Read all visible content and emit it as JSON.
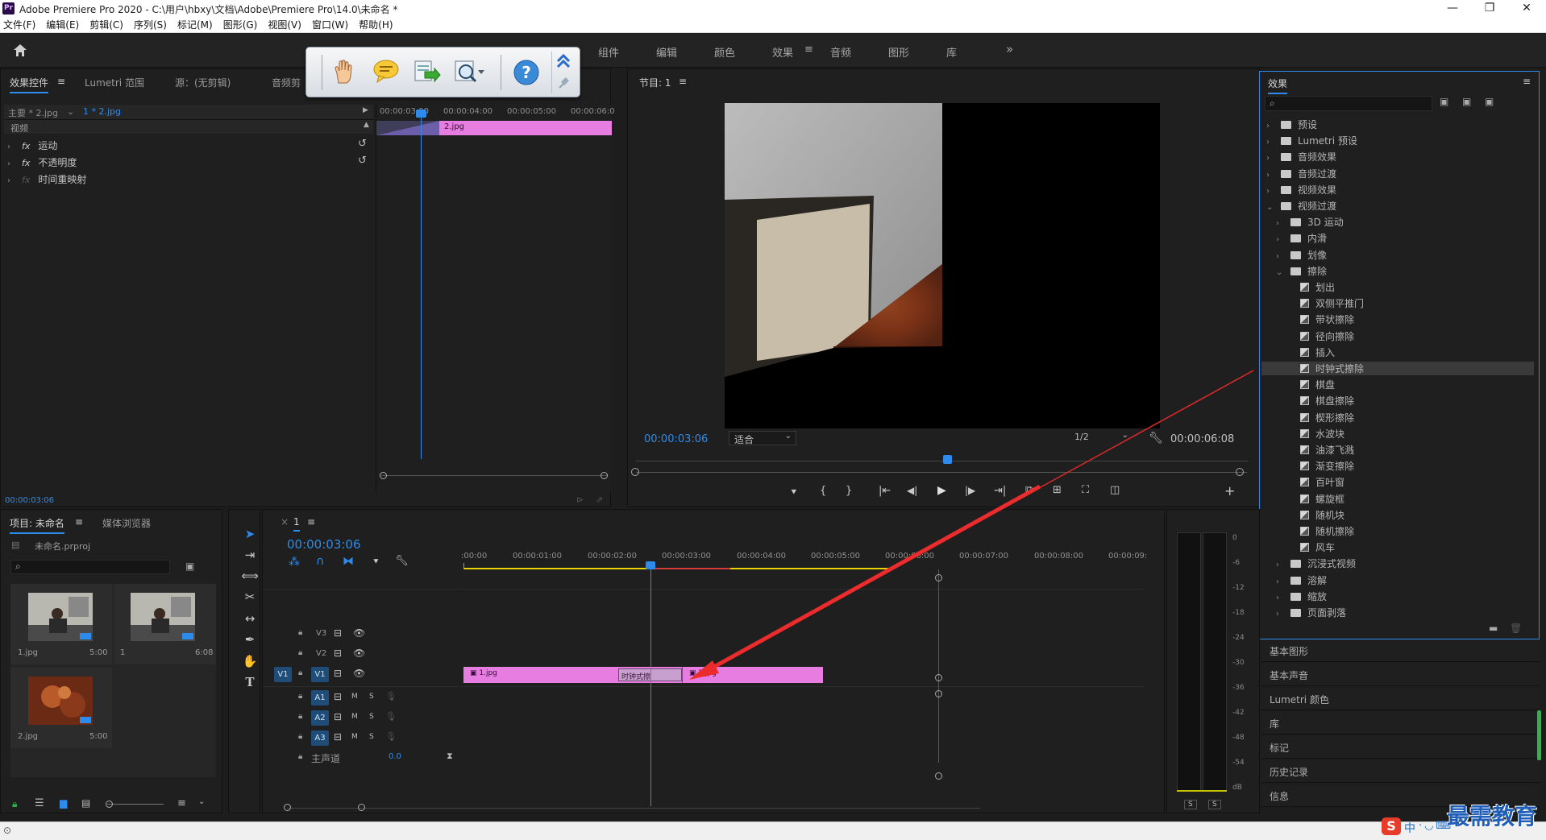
{
  "window": {
    "title": "Adobe Premiere Pro 2020 - C:\\用户\\hbxy\\文档\\Adobe\\Premiere Pro\\14.0\\未命名 *",
    "app_icon": "Pr"
  },
  "menu": [
    "文件(F)",
    "编辑(E)",
    "剪辑(C)",
    "序列(S)",
    "标记(M)",
    "图形(G)",
    "视图(V)",
    "窗口(W)",
    "帮助(H)"
  ],
  "workspaces": {
    "items": [
      "组件",
      "编辑",
      "颜色",
      "效果",
      "音频",
      "图形",
      "库"
    ],
    "active": "效果",
    "more": "»"
  },
  "effect_controls": {
    "tabs": [
      "效果控件",
      "Lumetri 范围",
      "源：(无剪辑)",
      "音频剪"
    ],
    "master": "主要 * 2.jpg",
    "clip": "1 * 2.jpg",
    "timecodes": [
      "00:00:03:00",
      "00:00:04:00",
      "00:00:05:00",
      "00:00:06:0"
    ],
    "section": "视频",
    "clip_label": "2.jpg",
    "props": [
      {
        "name": "运动",
        "fx": "fx"
      },
      {
        "name": "不透明度",
        "fx": "fx"
      },
      {
        "name": "时间重映射",
        "fx": "fx"
      }
    ],
    "current_time": "00:00:03:06"
  },
  "program": {
    "title": "节目: 1",
    "current_time": "00:00:03:06",
    "fit": "适合",
    "resolution": "1/2",
    "duration": "00:00:06:08"
  },
  "effects_panel": {
    "title": "效果",
    "tree": [
      {
        "label": "预设",
        "level": 0,
        "expanded": false
      },
      {
        "label": "Lumetri 预设",
        "level": 0,
        "expanded": false
      },
      {
        "label": "音频效果",
        "level": 0,
        "expanded": false
      },
      {
        "label": "音频过渡",
        "level": 0,
        "expanded": false
      },
      {
        "label": "视频效果",
        "level": 0,
        "expanded": false
      },
      {
        "label": "视频过渡",
        "level": 0,
        "expanded": true
      },
      {
        "label": "3D 运动",
        "level": 1,
        "expanded": false
      },
      {
        "label": "内滑",
        "level": 1,
        "expanded": false
      },
      {
        "label": "划像",
        "level": 1,
        "expanded": false
      },
      {
        "label": "擦除",
        "level": 1,
        "expanded": true
      },
      {
        "label": "划出",
        "level": 2,
        "effect": true
      },
      {
        "label": "双侧平推门",
        "level": 2,
        "effect": true
      },
      {
        "label": "带状擦除",
        "level": 2,
        "effect": true
      },
      {
        "label": "径向擦除",
        "level": 2,
        "effect": true
      },
      {
        "label": "插入",
        "level": 2,
        "effect": true
      },
      {
        "label": "时钟式擦除",
        "level": 2,
        "effect": true,
        "selected": true
      },
      {
        "label": "棋盘",
        "level": 2,
        "effect": true
      },
      {
        "label": "棋盘擦除",
        "level": 2,
        "effect": true
      },
      {
        "label": "楔形擦除",
        "level": 2,
        "effect": true
      },
      {
        "label": "水波块",
        "level": 2,
        "effect": true
      },
      {
        "label": "油漆飞溅",
        "level": 2,
        "effect": true
      },
      {
        "label": "渐变擦除",
        "level": 2,
        "effect": true
      },
      {
        "label": "百叶窗",
        "level": 2,
        "effect": true
      },
      {
        "label": "螺旋框",
        "level": 2,
        "effect": true
      },
      {
        "label": "随机块",
        "level": 2,
        "effect": true
      },
      {
        "label": "随机擦除",
        "level": 2,
        "effect": true
      },
      {
        "label": "风车",
        "level": 2,
        "effect": true
      },
      {
        "label": "沉浸式视频",
        "level": 1,
        "expanded": false
      },
      {
        "label": "溶解",
        "level": 1,
        "expanded": false
      },
      {
        "label": "缩放",
        "level": 1,
        "expanded": false
      },
      {
        "label": "页面剥落",
        "level": 1,
        "expanded": false
      }
    ],
    "side_panels": [
      "基本图形",
      "基本声音",
      "Lumetri 颜色",
      "库",
      "标记",
      "历史记录",
      "信息"
    ]
  },
  "project": {
    "tabs": [
      "项目: 未命名",
      "媒体浏览器"
    ],
    "file": "未命名.prproj",
    "items": [
      {
        "name": "1.jpg",
        "dur": "5:00"
      },
      {
        "name": "1",
        "dur": "6:08"
      },
      {
        "name": "2.jpg",
        "dur": "5:00"
      }
    ]
  },
  "timeline": {
    "tab": "1",
    "current_time": "00:00:03:06",
    "ruler": [
      ":00:00",
      "00:00:01:00",
      "00:00:02:00",
      "00:00:03:00",
      "00:00:04:00",
      "00:00:05:00",
      "00:00:06:00",
      "00:00:07:00",
      "00:00:08:00",
      "00:00:09:"
    ],
    "video_tracks": [
      "V3",
      "V2",
      "V1"
    ],
    "src_patch": "V1",
    "audio_tracks": [
      "A1",
      "A2",
      "A3"
    ],
    "master_label": "主声道",
    "master_val": "0.0",
    "clips": {
      "clip1": "1.jpg",
      "clip2": "2.jpg",
      "transition": "时钟式擦"
    },
    "M": "M",
    "S": "S"
  },
  "meter": {
    "scale": [
      "0",
      "-6",
      "-12",
      "-18",
      "-24",
      "-30",
      "-36",
      "-42",
      "-48",
      "-54",
      "dB"
    ],
    "solo": [
      "S",
      "S"
    ]
  },
  "watermark": "最需教育",
  "ime": "中"
}
